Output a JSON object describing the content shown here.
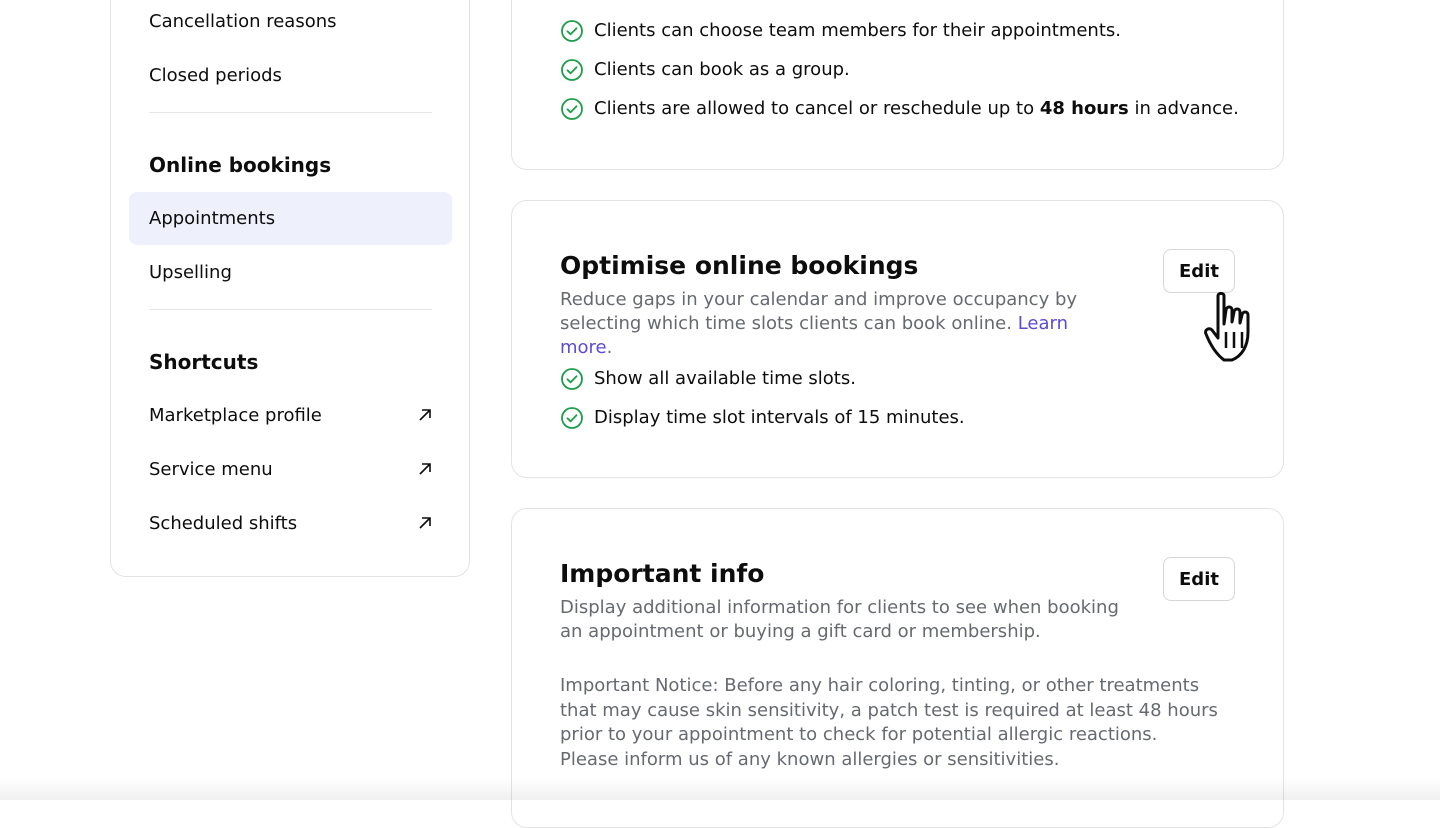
{
  "sidebar": {
    "items_top": [
      {
        "label": "Cancellation reasons"
      },
      {
        "label": "Closed periods"
      }
    ],
    "online_bookings": {
      "title": "Online bookings",
      "items": [
        {
          "label": "Appointments",
          "active": true
        },
        {
          "label": "Upselling"
        }
      ]
    },
    "shortcuts": {
      "title": "Shortcuts",
      "items": [
        {
          "label": "Marketplace profile",
          "icon": "external-arrow-icon"
        },
        {
          "label": "Service menu",
          "icon": "external-arrow-icon"
        },
        {
          "label": "Scheduled shifts",
          "icon": "external-arrow-icon"
        }
      ]
    }
  },
  "cards": {
    "booking_rules": {
      "items": [
        "Clients can choose team members for their appointments.",
        "Clients can book as a group."
      ],
      "cancel_prefix": "Clients are allowed to cancel or reschedule up to ",
      "cancel_bold": "48 hours",
      "cancel_suffix": " in advance."
    },
    "optimise": {
      "title": "Optimise online bookings",
      "description": "Reduce gaps in your calendar and improve occupancy by selecting which time slots clients can book online. ",
      "link": "Learn more",
      "link_suffix": ".",
      "edit_label": "Edit",
      "items": [
        "Show all available time slots.",
        "Display time slot intervals of 15 minutes."
      ]
    },
    "important_info": {
      "title": "Important info",
      "description": "Display additional information for clients to see when booking an appointment or buying a gift card or membership.",
      "edit_label": "Edit",
      "notice": "Important Notice: Before any hair coloring, tinting, or other treatments that may cause skin sensitivity, a patch test is required at least 48 hours prior to your appointment to check for potential allergic reactions. Please inform us of any known allergies or sensitivities."
    }
  },
  "colors": {
    "check_green": "#1e9e4a",
    "active_bg": "#eef0fb",
    "link": "#5b4bd6"
  }
}
